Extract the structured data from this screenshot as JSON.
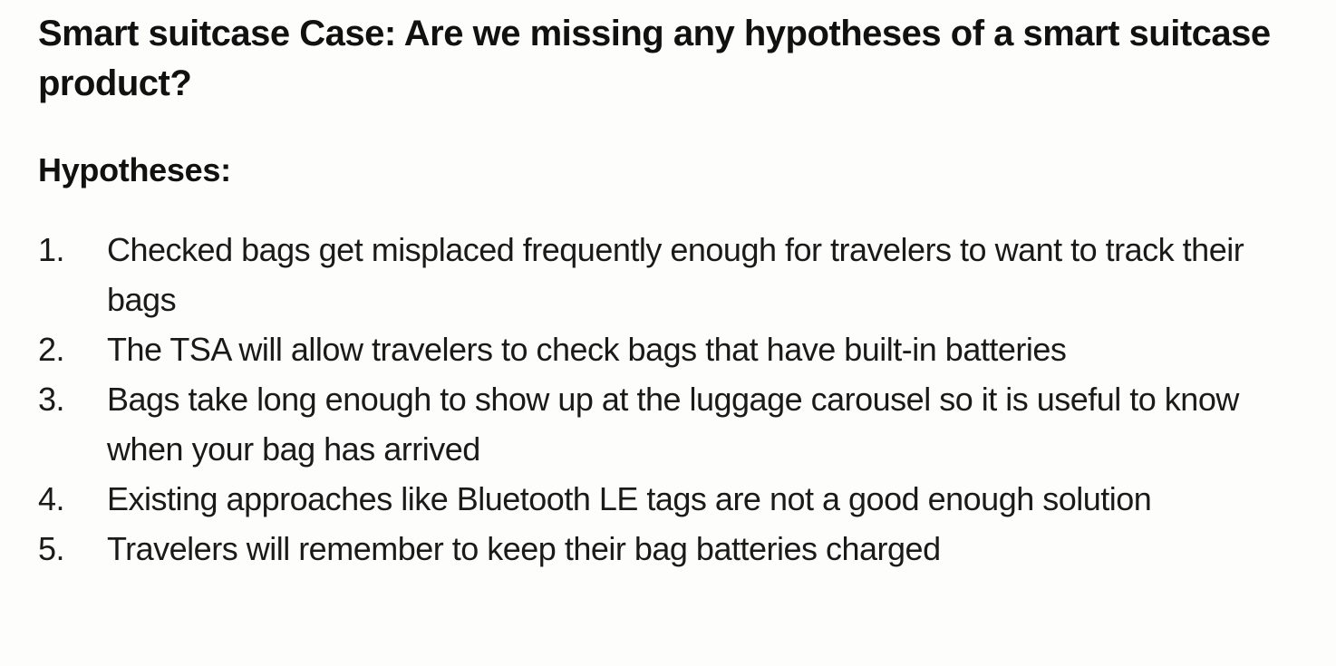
{
  "slide": {
    "title": "Smart suitcase Case: Are we missing any hypotheses of a smart suitcase product?",
    "subheading": "Hypotheses:",
    "items": [
      {
        "number": "1.",
        "text": "Checked bags get misplaced frequently enough for travelers to want to track their bags"
      },
      {
        "number": "2.",
        "text": "The TSA will allow travelers to check bags that have built-in batteries"
      },
      {
        "number": "3.",
        "text": "Bags take long enough to show up at the luggage carousel so it is useful to know when your bag has arrived"
      },
      {
        "number": "4.",
        "text": "Existing approaches like Bluetooth LE tags are not a good enough solution"
      },
      {
        "number": "5.",
        "text": "Travelers will remember to keep their bag batteries charged"
      }
    ]
  },
  "colors": {
    "background": "#fdfdfc",
    "text": "#111111"
  }
}
